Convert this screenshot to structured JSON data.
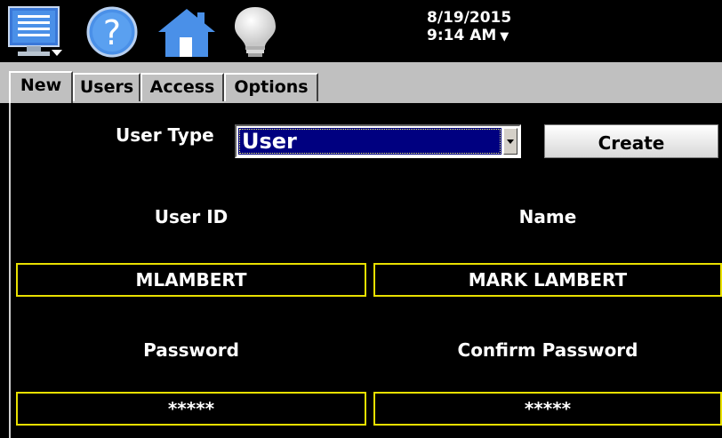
{
  "toolbar": {
    "menu_icon": "monitor-menu-icon",
    "help_icon": "help-icon",
    "home_icon": "home-icon",
    "light_icon": "lightbulb-icon",
    "date": "8/19/2015",
    "time": "9:14 AM",
    "time_arrow": "▼"
  },
  "tabs": [
    {
      "label": "New",
      "active": true
    },
    {
      "label": "Users",
      "active": false
    },
    {
      "label": "Access",
      "active": false
    },
    {
      "label": "Options",
      "active": false
    }
  ],
  "form": {
    "user_type_label": "User Type",
    "user_type_value": "User",
    "create_label": "Create",
    "user_id_label": "User ID",
    "user_id_value": "MLAMBERT",
    "name_label": "Name",
    "name_value": "MARK LAMBERT",
    "password_label": "Password",
    "password_value": "*****",
    "confirm_label": "Confirm Password",
    "confirm_value": "*****"
  },
  "colors": {
    "background": "#000000",
    "tab_strip": "#c0c0c0",
    "field_border": "#e8e000",
    "select_highlight": "#000080"
  }
}
